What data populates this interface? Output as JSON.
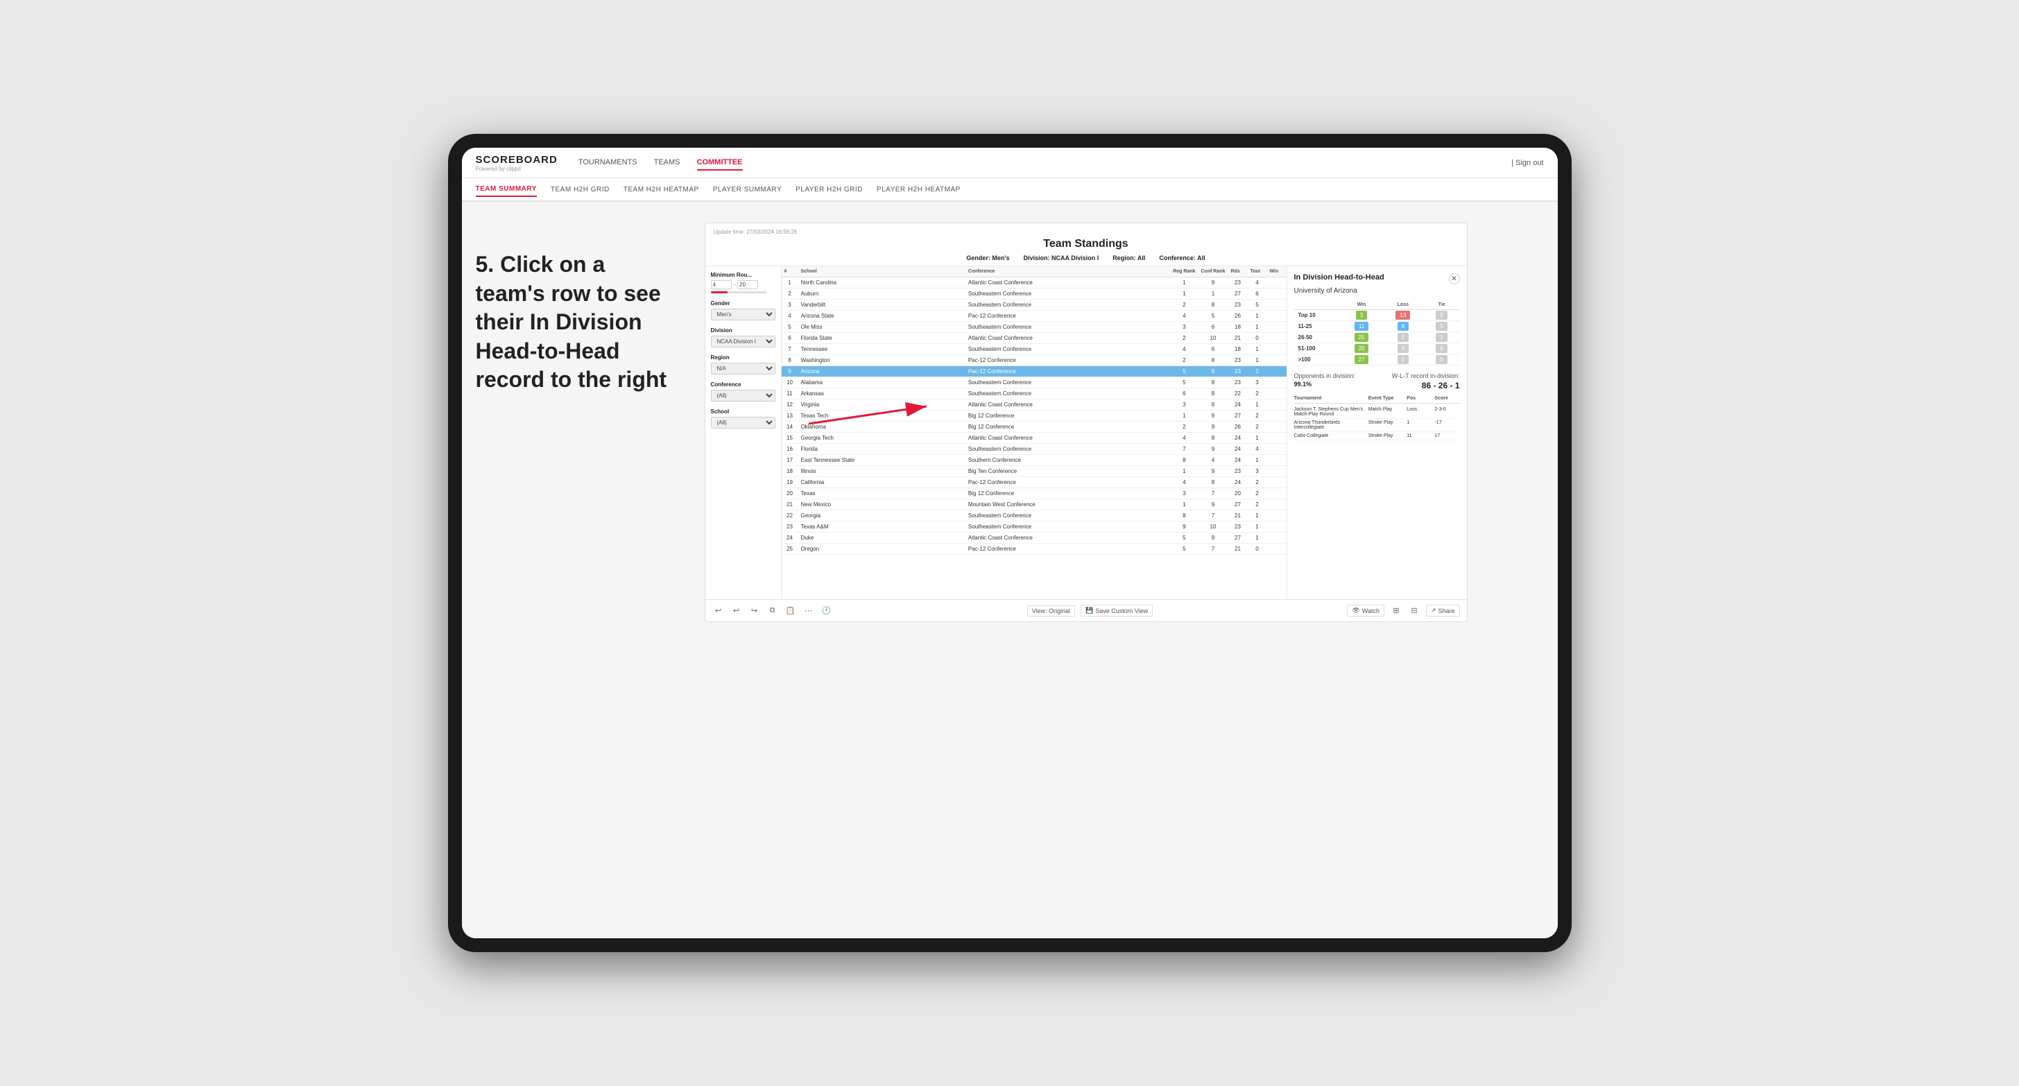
{
  "annotation": {
    "text": "5. Click on a team's row to see their In Division Head-to-Head record to the right"
  },
  "nav": {
    "logo": "SCOREBOARD",
    "logo_sub": "Powered by clippd",
    "links": [
      "TOURNAMENTS",
      "TEAMS",
      "COMMITTEE"
    ],
    "active_link": "COMMITTEE",
    "sign_out": "Sign out"
  },
  "sub_nav": {
    "links": [
      "TEAM SUMMARY",
      "TEAM H2H GRID",
      "TEAM H2H HEATMAP",
      "PLAYER SUMMARY",
      "PLAYER H2H GRID",
      "PLAYER H2H HEATMAP"
    ],
    "active": "PLAYER SUMMARY"
  },
  "panel": {
    "update_time": "Update time: 27/03/2024 16:56:26",
    "title": "Team Standings",
    "filters": {
      "gender": "Men's",
      "division": "NCAA Division I",
      "region": "All",
      "conference": "All"
    },
    "filter_labels": {
      "min_rou": "Minimum Rou...",
      "gender": "Gender",
      "division": "Division",
      "region": "Region",
      "conference": "Conference",
      "school": "School"
    },
    "filter_values": {
      "min_rou_val": "4",
      "min_rou_max": "20",
      "gender_val": "Men's",
      "division_val": "NCAA Division I",
      "region_val": "N/A",
      "conference_val": "(All)",
      "school_val": "(All)"
    },
    "table_headers": [
      "#",
      "School",
      "Conference",
      "Reg Rank",
      "Conf Rank",
      "Rds",
      "Tour",
      "Win"
    ],
    "teams": [
      {
        "rank": 1,
        "school": "North Carolina",
        "conference": "Atlantic Coast Conference",
        "reg": 1,
        "conf": 9,
        "rds": 23,
        "tour": 4,
        "win": null
      },
      {
        "rank": 2,
        "school": "Auburn",
        "conference": "Southeastern Conference",
        "reg": 1,
        "conf": 1,
        "rds": 27,
        "tour": 6,
        "win": null
      },
      {
        "rank": 3,
        "school": "Vanderbilt",
        "conference": "Southeastern Conference",
        "reg": 2,
        "conf": 8,
        "rds": 23,
        "tour": 5,
        "win": null
      },
      {
        "rank": 4,
        "school": "Arizona State",
        "conference": "Pac-12 Conference",
        "reg": 4,
        "conf": 5,
        "rds": 26,
        "tour": 1,
        "win": null
      },
      {
        "rank": 5,
        "school": "Ole Miss",
        "conference": "Southeastern Conference",
        "reg": 3,
        "conf": 6,
        "rds": 18,
        "tour": 1,
        "win": null
      },
      {
        "rank": 6,
        "school": "Florida State",
        "conference": "Atlantic Coast Conference",
        "reg": 2,
        "conf": 10,
        "rds": 21,
        "tour": 0,
        "win": null
      },
      {
        "rank": 7,
        "school": "Tennessee",
        "conference": "Southeastern Conference",
        "reg": 4,
        "conf": 6,
        "rds": 18,
        "tour": 1,
        "win": null
      },
      {
        "rank": 8,
        "school": "Washington",
        "conference": "Pac-12 Conference",
        "reg": 2,
        "conf": 8,
        "rds": 23,
        "tour": 1,
        "win": null
      },
      {
        "rank": 9,
        "school": "Arizona",
        "conference": "Pac-12 Conference",
        "reg": 5,
        "conf": 8,
        "rds": 23,
        "tour": 2,
        "win": null,
        "selected": true
      },
      {
        "rank": 10,
        "school": "Alabama",
        "conference": "Southeastern Conference",
        "reg": 5,
        "conf": 8,
        "rds": 23,
        "tour": 3,
        "win": null
      },
      {
        "rank": 11,
        "school": "Arkansas",
        "conference": "Southeastern Conference",
        "reg": 6,
        "conf": 8,
        "rds": 22,
        "tour": 2,
        "win": null
      },
      {
        "rank": 12,
        "school": "Virginia",
        "conference": "Atlantic Coast Conference",
        "reg": 3,
        "conf": 8,
        "rds": 24,
        "tour": 1,
        "win": null
      },
      {
        "rank": 13,
        "school": "Texas Tech",
        "conference": "Big 12 Conference",
        "reg": 1,
        "conf": 9,
        "rds": 27,
        "tour": 2,
        "win": null
      },
      {
        "rank": 14,
        "school": "Oklahoma",
        "conference": "Big 12 Conference",
        "reg": 2,
        "conf": 9,
        "rds": 26,
        "tour": 2,
        "win": null
      },
      {
        "rank": 15,
        "school": "Georgia Tech",
        "conference": "Atlantic Coast Conference",
        "reg": 4,
        "conf": 8,
        "rds": 24,
        "tour": 1,
        "win": null
      },
      {
        "rank": 16,
        "school": "Florida",
        "conference": "Southeastern Conference",
        "reg": 7,
        "conf": 9,
        "rds": 24,
        "tour": 4,
        "win": null
      },
      {
        "rank": 17,
        "school": "East Tennessee State",
        "conference": "Southern Conference",
        "reg": 8,
        "conf": 4,
        "rds": 24,
        "tour": 1,
        "win": null
      },
      {
        "rank": 18,
        "school": "Illinois",
        "conference": "Big Ten Conference",
        "reg": 1,
        "conf": 9,
        "rds": 23,
        "tour": 3,
        "win": null
      },
      {
        "rank": 19,
        "school": "California",
        "conference": "Pac-12 Conference",
        "reg": 4,
        "conf": 8,
        "rds": 24,
        "tour": 2,
        "win": null
      },
      {
        "rank": 20,
        "school": "Texas",
        "conference": "Big 12 Conference",
        "reg": 3,
        "conf": 7,
        "rds": 20,
        "tour": 2,
        "win": null
      },
      {
        "rank": 21,
        "school": "New Mexico",
        "conference": "Mountain West Conference",
        "reg": 1,
        "conf": 9,
        "rds": 27,
        "tour": 2,
        "win": null
      },
      {
        "rank": 22,
        "school": "Georgia",
        "conference": "Southeastern Conference",
        "reg": 8,
        "conf": 7,
        "rds": 21,
        "tour": 1,
        "win": null
      },
      {
        "rank": 23,
        "school": "Texas A&M",
        "conference": "Southeastern Conference",
        "reg": 9,
        "conf": 10,
        "rds": 23,
        "tour": 1,
        "win": null
      },
      {
        "rank": 24,
        "school": "Duke",
        "conference": "Atlantic Coast Conference",
        "reg": 5,
        "conf": 9,
        "rds": 27,
        "tour": 1,
        "win": null
      },
      {
        "rank": 25,
        "school": "Oregon",
        "conference": "Pac-12 Conference",
        "reg": 5,
        "conf": 7,
        "rds": 21,
        "tour": 0,
        "win": null
      }
    ],
    "h2h": {
      "title": "In Division Head-to-Head",
      "team": "University of Arizona",
      "grid_headers": [
        "Win",
        "Loss",
        "Tie"
      ],
      "grid_rows": [
        {
          "range": "Top 10",
          "win": 3,
          "loss": 13,
          "tie": 0,
          "win_color": "green",
          "loss_color": "red",
          "tie_color": "gray"
        },
        {
          "range": "11-25",
          "win": 11,
          "loss": 8,
          "tie": 0,
          "win_color": "blue",
          "loss_color": "blue",
          "tie_color": "gray"
        },
        {
          "range": "26-50",
          "win": 25,
          "loss": 2,
          "tie": 1,
          "win_color": "green",
          "loss_color": "gray",
          "tie_color": "gray"
        },
        {
          "range": "51-100",
          "win": 20,
          "loss": 3,
          "tie": 0,
          "win_color": "green",
          "loss_color": "gray",
          "tie_color": "gray"
        },
        {
          "range": ">100",
          "win": 27,
          "loss": 0,
          "tie": 0,
          "win_color": "green",
          "loss_color": "gray",
          "tie_color": "gray"
        }
      ],
      "opponents_label": "Opponents in division:",
      "opponents_value": "99.1%",
      "record_label": "W-L-T record in-division:",
      "record_value": "86 - 26 - 1",
      "tournaments": [
        {
          "name": "Jackson T. Stephens Cup Men's Match-Play Round",
          "event_type": "Match Play",
          "pos": "Loss",
          "score": "2-3-0"
        },
        {
          "name": "Arizona Thunderbirds Intercollegiate",
          "event_type": "Stroke Play",
          "pos": "1",
          "score": "-17"
        },
        {
          "name": "Cabo Collegiate",
          "event_type": "Stroke Play",
          "pos": "11",
          "score": "17"
        }
      ],
      "tourn_headers": [
        "Tournament",
        "Event Type",
        "Pos",
        "Score"
      ]
    },
    "toolbar": {
      "view_original": "View: Original",
      "save_custom": "Save Custom View",
      "watch": "Watch",
      "share": "Share"
    }
  }
}
